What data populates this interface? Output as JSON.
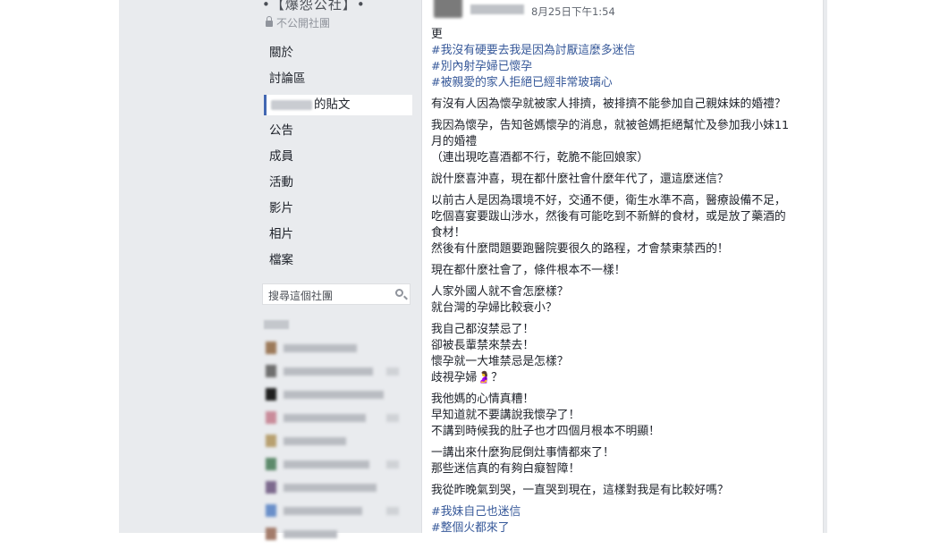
{
  "group": {
    "title": "•【爆怨公社】•",
    "privacy": "不公開社團"
  },
  "nav": [
    {
      "label": "關於"
    },
    {
      "label": "討論區"
    },
    {
      "label": "的貼文"
    },
    {
      "label": "公告"
    },
    {
      "label": "成員"
    },
    {
      "label": "活動"
    },
    {
      "label": "影片"
    },
    {
      "label": "相片"
    },
    {
      "label": "檔案"
    }
  ],
  "search": {
    "placeholder": "搜尋這個社團"
  },
  "post": {
    "date": "8月25日下午1:54",
    "paragraphs": [
      {
        "lines": [
          {
            "text": "更",
            "tag": false
          },
          {
            "text": "#我沒有硬要去我是因為討厭這麼多迷信",
            "tag": true
          },
          {
            "text": "#別內射孕婦已懷孕",
            "tag": true
          },
          {
            "text": "#被親愛的家人拒絕已經非常玻璃心",
            "tag": true
          }
        ]
      },
      {
        "lines": [
          {
            "text": "有沒有人因為懷孕就被家人排擠，被排擠不能參加自己親妹妹的婚禮？",
            "tag": false
          }
        ]
      },
      {
        "lines": [
          {
            "text": "我因為懷孕，告知爸媽懷孕的消息，就被爸媽拒絕幫忙及參加我小妹11",
            "tag": false
          },
          {
            "text": "月的婚禮",
            "tag": false
          },
          {
            "text": "（連出現吃喜酒都不行，乾脆不能回娘家）",
            "tag": false
          }
        ]
      },
      {
        "lines": [
          {
            "text": "說什麼喜沖喜，現在都什麼社會什麼年代了，還這麼迷信？",
            "tag": false
          }
        ]
      },
      {
        "lines": [
          {
            "text": "以前古人是因為環境不好，交通不便，衛生水準不高，醫療設備不足，",
            "tag": false
          },
          {
            "text": "吃個喜宴要跋山涉水，然後有可能吃到不新鮮的食材，或是放了藥酒的",
            "tag": false
          },
          {
            "text": "食材！",
            "tag": false
          },
          {
            "text": "然後有什麼問題要跑醫院要很久的路程，才會禁東禁西的！",
            "tag": false
          }
        ]
      },
      {
        "lines": [
          {
            "text": "現在都什麼社會了，條件根本不一樣！",
            "tag": false
          }
        ]
      },
      {
        "lines": [
          {
            "text": "人家外國人就不會怎麼樣？",
            "tag": false
          },
          {
            "text": "就台灣的孕婦比較衰小？",
            "tag": false
          }
        ]
      },
      {
        "lines": [
          {
            "text": "我自己都沒禁忌了！",
            "tag": false
          },
          {
            "text": "卻被長輩禁來禁去！",
            "tag": false
          },
          {
            "text": "懷孕就一大堆禁忌是怎樣？",
            "tag": false
          },
          {
            "text": "歧視孕婦🤰？",
            "tag": false
          }
        ]
      },
      {
        "lines": [
          {
            "text": "我他媽的心情真糟！",
            "tag": false
          },
          {
            "text": "早知道就不要講說我懷孕了！",
            "tag": false
          },
          {
            "text": "不講到時候我的肚子也才四個月根本不明顯！",
            "tag": false
          }
        ]
      },
      {
        "lines": [
          {
            "text": "一講出來什麼狗屁倒灶事情都來了！",
            "tag": false
          },
          {
            "text": "那些迷信真的有夠白癡智障！",
            "tag": false
          }
        ]
      },
      {
        "lines": [
          {
            "text": "我從昨晚氣到哭，一直哭到現在，這樣對我是有比較好嗎？",
            "tag": false
          }
        ]
      },
      {
        "lines": [
          {
            "text": "#我妹自己也迷信",
            "tag": true
          },
          {
            "text": "#整個火都來了",
            "tag": true
          }
        ]
      }
    ]
  }
}
